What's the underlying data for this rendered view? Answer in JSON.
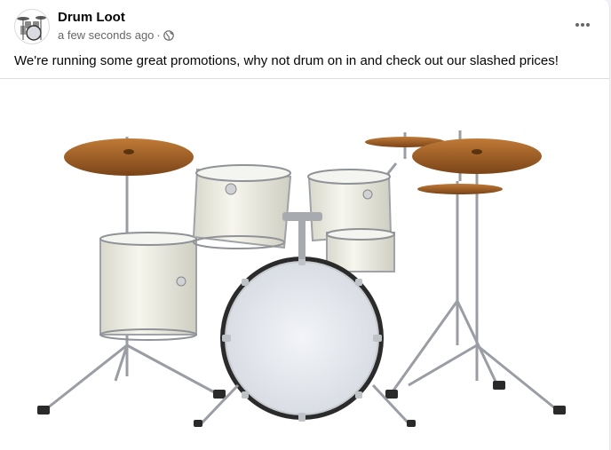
{
  "post": {
    "page_name": "Drum Loot",
    "timestamp": "a few seconds ago",
    "separator": "·",
    "privacy_icon": "globe-icon",
    "more_icon": "more-options-icon",
    "caption": "We're running some great promotions, why not drum on in and check out our slashed prices!"
  },
  "colors": {
    "name": "#050505",
    "meta": "#65676b",
    "cymbal": "#b06a2c",
    "drum_shell": "#ecebe2",
    "bass_head": "#e8ebf0"
  }
}
